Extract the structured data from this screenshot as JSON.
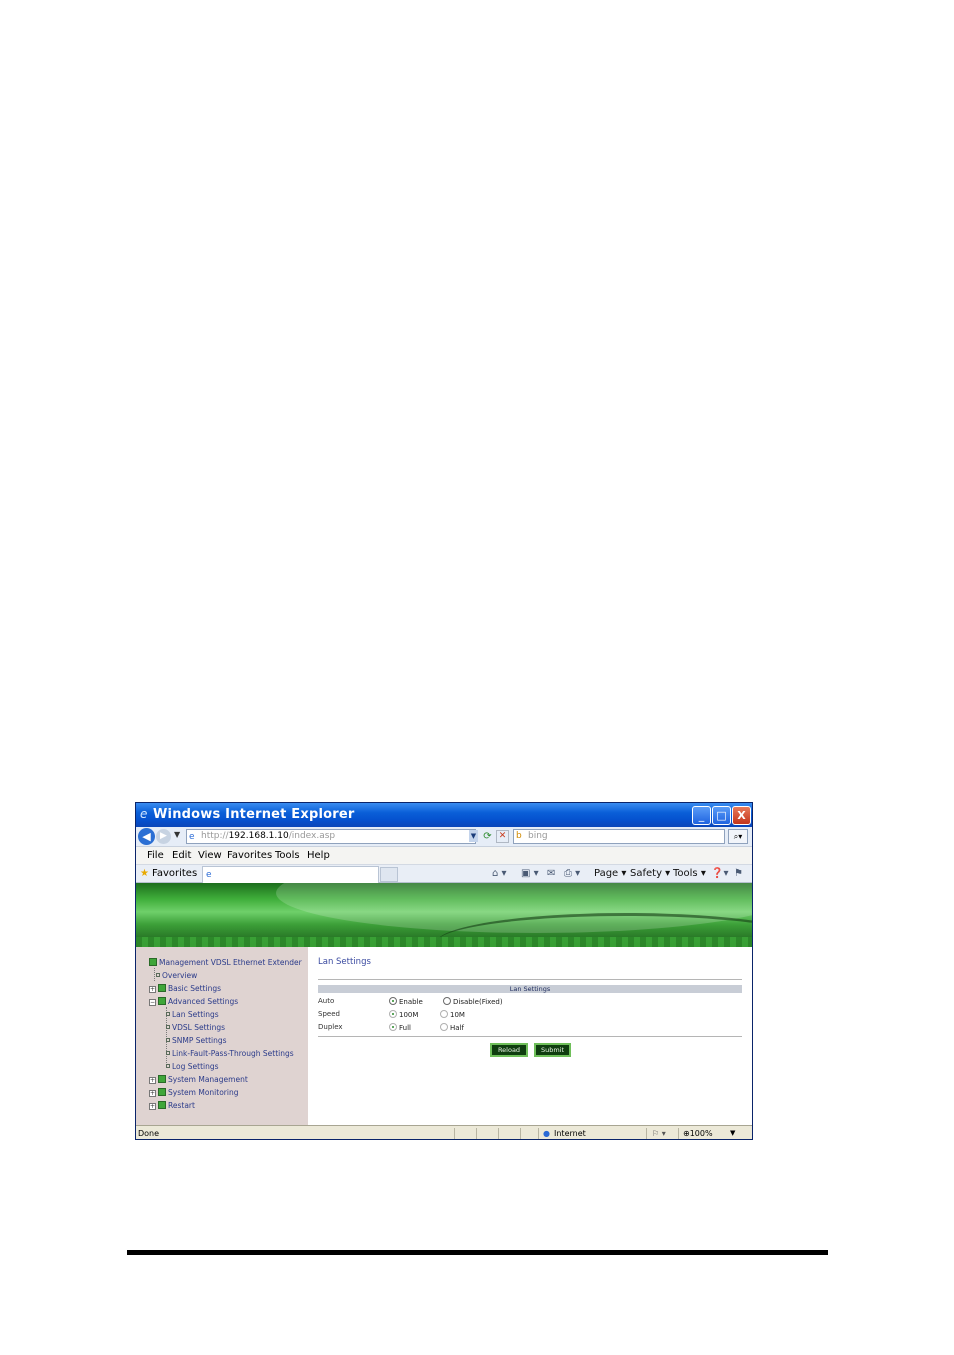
{
  "window": {
    "title": "Windows Internet Explorer",
    "minimize": "_",
    "maximize": "□",
    "close": "X"
  },
  "address": {
    "url_prefix": "http://",
    "url_host": "192.168.1.10",
    "url_path": "/index.asp",
    "search_placeholder": "bing"
  },
  "menu": [
    "File",
    "Edit",
    "View",
    "Favorites",
    "Tools",
    "Help"
  ],
  "favorites_bar": {
    "label": "Favorites",
    "commands": [
      "Page",
      "Safety",
      "Tools"
    ]
  },
  "sidebar": {
    "root": "Management VDSL Ethernet Extender",
    "items": [
      "Overview",
      "Basic Settings",
      "Advanced Settings",
      "Lan Settings",
      "VDSL Settings",
      "SNMP Settings",
      "Link-Fault-Pass-Through Settings",
      "Log Settings",
      "System Management",
      "System Monitoring",
      "Restart"
    ]
  },
  "content": {
    "page_title": "Lan Settings",
    "section_header": "Lan Settings",
    "fields": [
      {
        "label": "Auto",
        "option1": "Enable",
        "option2": "Disable(Fixed)",
        "selected": "option1"
      },
      {
        "label": "Speed",
        "option1": "100M",
        "option2": "10M",
        "selected": "option1"
      },
      {
        "label": "Duplex",
        "option1": "Full",
        "option2": "Half",
        "selected": "option1"
      }
    ],
    "reload_label": "Reload",
    "submit_label": "Submit"
  },
  "status": {
    "text": "Done",
    "zone": "Internet",
    "zoom": "100%"
  },
  "colors": {
    "titlebar": "#0551cf",
    "banner_green": "#3fae3a",
    "sidebar_bg": "#dfd3d1",
    "button_bg": "#0f3d0f"
  }
}
